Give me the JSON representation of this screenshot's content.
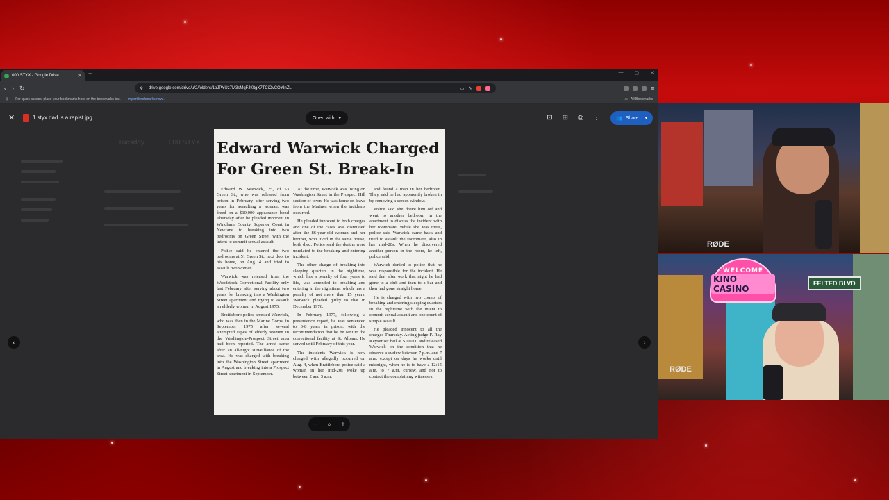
{
  "browser": {
    "tab_title": "000 STYX - Google Drive",
    "new_tab_glyph": "+",
    "url": "drive.google.com/drive/u/2/folders/1oJPYUz7M3sMqFJt0tgX7TCiOvCOYInZL",
    "bookmarks_hint": "For quick access, place your bookmarks here on the bookmarks bar.",
    "import_link": "Import bookmarks now...",
    "all_bookmarks": "All Bookmarks"
  },
  "viewer": {
    "file_name": "1 styx dad is a rapist.jpg",
    "open_with": "Open with",
    "share": "Share",
    "drive_bg": {
      "location": "Tuesday",
      "folder": "000 STYX"
    }
  },
  "article": {
    "headline_line1": "Edward Warwick Charged",
    "headline_line2": "For Green St. Break-In",
    "col1": [
      "Edward W. Warwick, 25, of 53 Green St., who was released from prison in February after serving two years for assaulting a woman, was freed on a $10,000 appearance bond Thursday after he pleaded innocent in Windham County Superior Court in Newfane to breaking into two bedrooms on Green Street with the intent to commit sexual assault.",
      "Police said he entered the two bedrooms at 51 Green St., next door to his home, on Aug. 4 and tried to assault two women.",
      "Warwick was released from the Woodstock Correctional Facility only last February after serving about two years for breaking into a Washington Street apartment and trying to assault an elderly woman in August 1975.",
      "Brattleboro police arrested Warwick, who was then in the Marine Corps, in September 1975 after several attempted rapes of elderly women in the Washington-Prospect Street area had been reported. The arrest came after an all-night surveillance of the area. He was charged with breaking into the Washington Street apartment in August and breaking into a Prospect Street apartment in September."
    ],
    "col2": [
      "At the time, Warwick was living on Washington Street in the Prospect Hill section of town. He was home on leave from the Marines when the incidents occurred.",
      "He pleaded innocent to both charges and one of the cases was dismissed after the 86-year-old woman and her brother, who lived in the same house, both died. Police said the deaths were unrelated to the breaking and entering incident.",
      "The other charge of breaking into sleeping quarters in the nighttime, which has a penalty of four years to life, was amended to breaking and entering in the nighttime, which has a penalty of not more than 15 years. Warwick pleaded guilty to that in December 1976.",
      "In February 1977, following a presentence report, he was sentenced to 3-8 years in prison, with the recommendation that he be sent to the correctional facility at St. Albans. He served until February of this year.",
      "The incidents Warwick is now charged with allegedly occurred on Aug. 4, when Brattleboro police said a woman in her mid-20s woke up between 2 and 3 a.m."
    ],
    "col3": [
      "and found a man in her bedroom. They said he had apparently broken in by removing a screen window.",
      "Police said she drove him off and went to another bedroom in the apartment to discuss the incident with her roommate. While she was there, police said Warwick came back and tried to assault the roommate, also in her mid-20s. When he discovered another person in the room, he left, police said.",
      "Warwick denied to police that he was responsible for the incident. He said that after work that night he had gone to a club and then to a bar and then had gone straight home.",
      "He is charged with two counts of breaking and entering sleeping quarters in the nighttime with the intent to commit sexual assault and one count of simple assault.",
      "He pleaded innocent to all the charges Thursday. Acting judge F. Ray Keyser set bail at $10,000 and released Warwick on the condition that he observe a curfew between 7 p.m. and 7 a.m. except on days he works until midnight, when he is to have a 12:15 a.m. to 7 a.m. curfew, and not to contact the complaining witnesses."
    ]
  },
  "webcam": {
    "sign_welcome": "WELCOME",
    "sign_name": "KINO CASINO",
    "street_sign": "FELTED BLVD",
    "mic_brand": "RØDE"
  },
  "icons": [
    "close-icon",
    "image-file-icon",
    "chevron-down-icon",
    "add-to-folder-icon",
    "comment-icon",
    "print-icon",
    "more-vert-icon",
    "share-people-icon",
    "chevron-left-icon",
    "chevron-right-icon",
    "zoom-out-icon",
    "zoom-search-icon",
    "zoom-in-icon"
  ],
  "colors": {
    "share_button": "#1f5fbf",
    "viewer_bg": "#2b2b2d",
    "stream_bg": "#8e0000"
  }
}
